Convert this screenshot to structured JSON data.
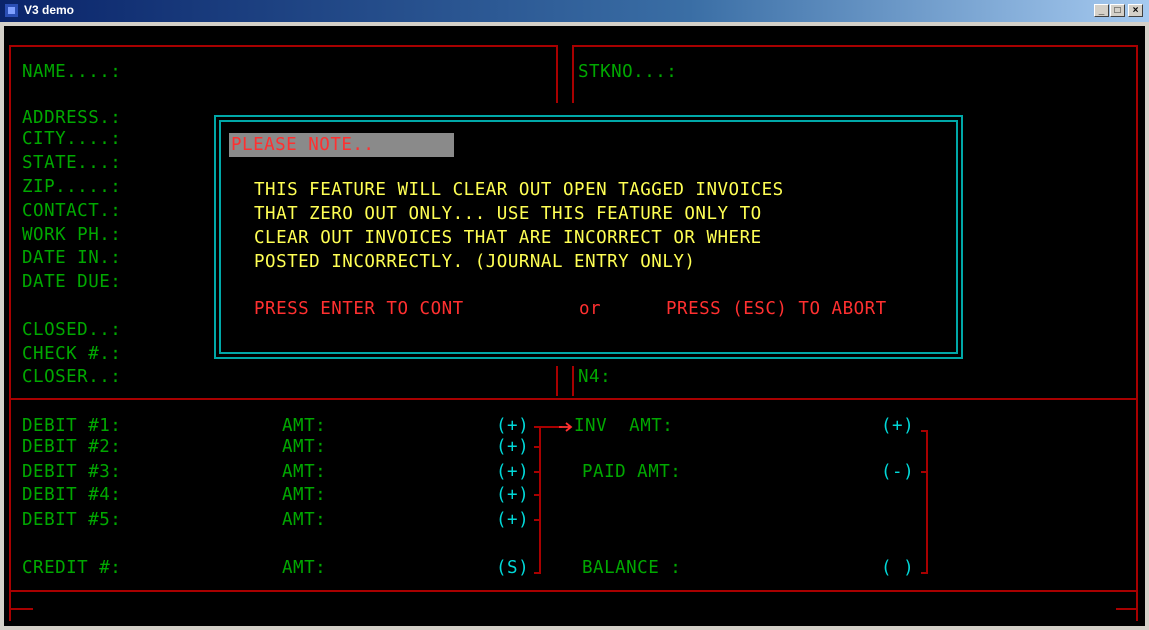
{
  "window": {
    "title": "V3 demo",
    "minimize": "_",
    "maximize": "□",
    "close": "×"
  },
  "left_fields": [
    "NAME....:",
    "ADDRESS.:",
    "CITY....:",
    "STATE...:",
    "ZIP.....:",
    "CONTACT.:",
    "WORK PH.:",
    "DATE IN.:",
    "DATE DUE:",
    "CLOSED..:",
    "CHECK #.:",
    "CLOSER..:"
  ],
  "right_fields": {
    "stkno": "STKNO...:",
    "n4": "N4:"
  },
  "dialog": {
    "header": "PLEASE NOTE..",
    "lines": [
      "THIS FEATURE WILL CLEAR OUT OPEN TAGGED INVOICES",
      "THAT ZERO OUT ONLY... USE THIS FEATURE ONLY TO",
      "CLEAR OUT INVOICES THAT ARE INCORRECT OR WHERE",
      "POSTED INCORRECTLY. (JOURNAL ENTRY ONLY)"
    ],
    "enter_prompt": "PRESS ENTER TO CONT",
    "or": "or",
    "esc_prompt": "PRESS (ESC) TO ABORT"
  },
  "debits": [
    {
      "label": "DEBIT #1:",
      "amt": "AMT:",
      "sign": "(+)"
    },
    {
      "label": "DEBIT #2:",
      "amt": "AMT:",
      "sign": "(+)"
    },
    {
      "label": "DEBIT #3:",
      "amt": "AMT:",
      "sign": "(+)"
    },
    {
      "label": "DEBIT #4:",
      "amt": "AMT:",
      "sign": "(+)"
    },
    {
      "label": "DEBIT #5:",
      "amt": "AMT:",
      "sign": "(+)"
    }
  ],
  "credit": {
    "label": "CREDIT #:",
    "amt": "AMT:",
    "sign": "(S)"
  },
  "totals": {
    "inv_label": "INV  AMT:",
    "inv_sign": "(+)",
    "paid_label": "PAID AMT:",
    "paid_sign": "(-)",
    "balance_label": "BALANCE :",
    "balance_sign": "( )"
  }
}
